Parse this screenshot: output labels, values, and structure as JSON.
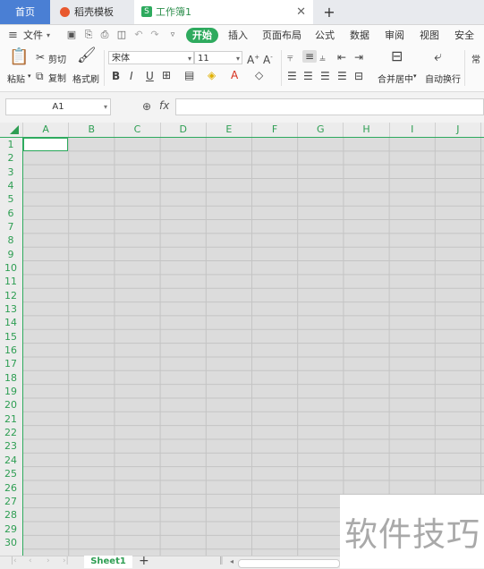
{
  "tabs": {
    "home": "首页",
    "template": "稻壳模板",
    "workbook": "工作簿1",
    "workbook_icon": "S",
    "close": "✕",
    "add": "+"
  },
  "menu": {
    "file": "文件",
    "items": [
      "开始",
      "插入",
      "页面布局",
      "公式",
      "数据",
      "审阅",
      "视图",
      "安全"
    ]
  },
  "ribbon": {
    "paste": "粘贴",
    "cut": "剪切",
    "copy": "复制",
    "format_painter": "格式刷",
    "font_name": "宋体",
    "font_size": "11",
    "bold": "B",
    "italic": "I",
    "underline": "U",
    "merge_center": "合并居中",
    "wrap_text": "自动换行",
    "general": "常"
  },
  "formula_bar": {
    "cell_ref": "A1",
    "fx": "fx"
  },
  "grid": {
    "columns": [
      "A",
      "B",
      "C",
      "D",
      "E",
      "F",
      "G",
      "H",
      "I",
      "J"
    ],
    "rows": [
      "1",
      "2",
      "3",
      "4",
      "5",
      "6",
      "7",
      "8",
      "9",
      "10",
      "11",
      "12",
      "13",
      "14",
      "15",
      "16",
      "17",
      "18",
      "19",
      "20",
      "21",
      "22",
      "23",
      "24",
      "25",
      "26",
      "27",
      "28",
      "29",
      "30"
    ],
    "active_cell": "A1"
  },
  "sheets": {
    "active": "Sheet1",
    "add": "+"
  },
  "watermark": "软件技巧",
  "colors": {
    "accent": "#2eaa5e",
    "home_tab": "#4a7fd4",
    "cell_area": "#dcdcdc"
  }
}
